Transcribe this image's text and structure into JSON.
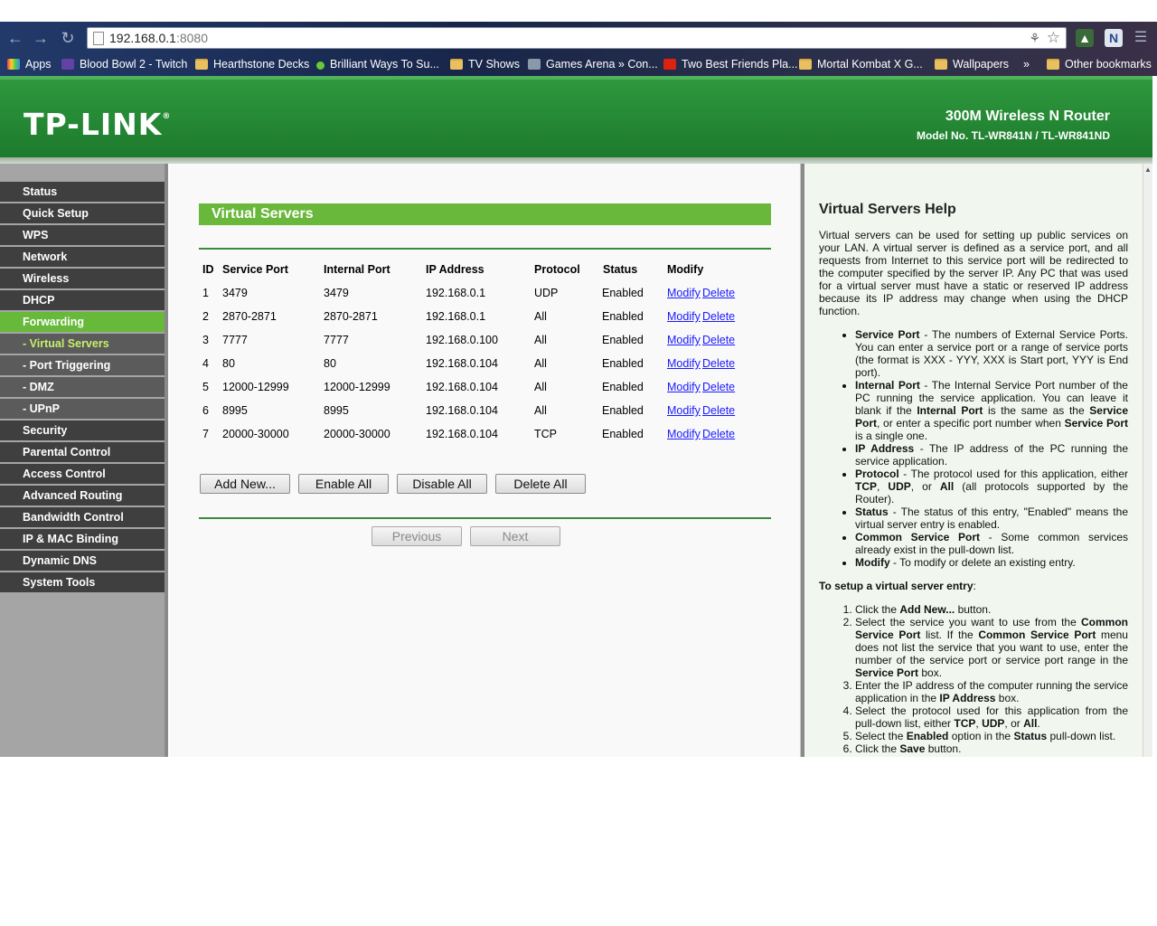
{
  "browser": {
    "url_host": "192.168.0.1",
    "url_port": ":8080",
    "bookmarks": [
      {
        "label": "Apps",
        "icon": "apps-grid-icon"
      },
      {
        "label": "Blood Bowl 2 - Twitch",
        "icon": "twitch-icon"
      },
      {
        "label": "Hearthstone Decks",
        "icon": "folder-icon"
      },
      {
        "label": "Brilliant Ways To Su...",
        "icon": "green-dot-icon"
      },
      {
        "label": "TV Shows",
        "icon": "folder-icon"
      },
      {
        "label": "Games Arena » Con...",
        "icon": "site-icon"
      },
      {
        "label": "Two Best Friends Pla...",
        "icon": "youtube-icon"
      },
      {
        "label": "Mortal Kombat X G...",
        "icon": "folder-icon"
      },
      {
        "label": "Wallpapers",
        "icon": "folder-icon"
      },
      {
        "label": "»",
        "icon": ""
      },
      {
        "label": "Other bookmarks",
        "icon": "folder-icon"
      }
    ]
  },
  "header": {
    "logo": "TP-LINK",
    "product": "300M Wireless N Router",
    "model": "Model No. TL-WR841N / TL-WR841ND"
  },
  "sidebar": {
    "items": [
      {
        "label": "Status"
      },
      {
        "label": "Quick Setup"
      },
      {
        "label": "WPS"
      },
      {
        "label": "Network"
      },
      {
        "label": "Wireless"
      },
      {
        "label": "DHCP"
      },
      {
        "label": "Forwarding"
      },
      {
        "label": "- Virtual Servers"
      },
      {
        "label": "- Port Triggering"
      },
      {
        "label": "- DMZ"
      },
      {
        "label": "- UPnP"
      },
      {
        "label": "Security"
      },
      {
        "label": "Parental Control"
      },
      {
        "label": "Access Control"
      },
      {
        "label": "Advanced Routing"
      },
      {
        "label": "Bandwidth Control"
      },
      {
        "label": "IP & MAC Binding"
      },
      {
        "label": "Dynamic DNS"
      },
      {
        "label": "System Tools"
      }
    ]
  },
  "main": {
    "title": "Virtual Servers",
    "columns": [
      "ID",
      "Service Port",
      "Internal Port",
      "IP Address",
      "Protocol",
      "Status",
      "Modify"
    ],
    "rows": [
      {
        "id": "1",
        "service_port": "3479",
        "internal_port": "3479",
        "ip": "192.168.0.1",
        "protocol": "UDP",
        "status": "Enabled"
      },
      {
        "id": "2",
        "service_port": "2870-2871",
        "internal_port": "2870-2871",
        "ip": "192.168.0.1",
        "protocol": "All",
        "status": "Enabled"
      },
      {
        "id": "3",
        "service_port": "7777",
        "internal_port": "7777",
        "ip": "192.168.0.100",
        "protocol": "All",
        "status": "Enabled"
      },
      {
        "id": "4",
        "service_port": "80",
        "internal_port": "80",
        "ip": "192.168.0.104",
        "protocol": "All",
        "status": "Enabled"
      },
      {
        "id": "5",
        "service_port": "12000-12999",
        "internal_port": "12000-12999",
        "ip": "192.168.0.104",
        "protocol": "All",
        "status": "Enabled"
      },
      {
        "id": "6",
        "service_port": "8995",
        "internal_port": "8995",
        "ip": "192.168.0.104",
        "protocol": "All",
        "status": "Enabled"
      },
      {
        "id": "7",
        "service_port": "20000-30000",
        "internal_port": "20000-30000",
        "ip": "192.168.0.104",
        "protocol": "TCP",
        "status": "Enabled"
      }
    ],
    "modify_label": "Modify",
    "delete_label": "Delete",
    "buttons": {
      "add_new": "Add New...",
      "enable_all": "Enable All",
      "disable_all": "Disable All",
      "delete_all": "Delete All"
    },
    "pager": {
      "previous": "Previous",
      "next": "Next"
    }
  },
  "help": {
    "title": "Virtual Servers Help",
    "intro": "Virtual servers can be used for setting up public services on your LAN. A virtual server is defined as a service port, and all requests from Internet to this service port will be redirected to the computer specified by the server IP. Any PC that was used for a virtual server must have a static or reserved IP address because its IP address may change when using the DHCP function.",
    "b1_term": "Service Port",
    "b1_text": " - The numbers of External Service Ports. You can enter a service port or a range of service ports (the format is XXX - YYY, XXX is Start port, YYY is End port).",
    "b2_term": "Internal Port",
    "b2_text_a": " - The Internal Service Port number of the PC running the service application. You can leave it blank if the ",
    "b2_term2": "Internal Port",
    "b2_text_b": " is the same as the ",
    "b2_term3": "Service Port",
    "b2_text_c": ", or enter a specific port number when ",
    "b2_term4": "Service Port",
    "b2_text_d": " is a single one.",
    "b3_term": "IP Address",
    "b3_text": " - The IP address of the PC running the service application.",
    "b4_term": "Protocol",
    "b4_text_a": " - The protocol used for this application, either ",
    "b4_tcp": "TCP",
    "b4_sep1": ", ",
    "b4_udp": "UDP",
    "b4_sep2": ", or ",
    "b4_all": "All",
    "b4_text_b": " (all protocols supported by the Router).",
    "b5_term": "Status",
    "b5_text": " - The status of this entry, \"Enabled\" means the virtual server entry is enabled.",
    "b6_term": "Common Service Port",
    "b6_text": " - Some common services already exist in the pull-down list.",
    "b7_term": "Modify",
    "b7_text": " - To modify or delete an existing entry.",
    "setup_term": "To setup a virtual server entry",
    "setup_colon": ":",
    "s1_a": "Click the ",
    "s1_b": "Add New...",
    "s1_c": " button.",
    "s2_a": "Select the service you want to use from the ",
    "s2_b": "Common Service Port",
    "s2_c": " list. If the ",
    "s2_d": "Common Service Port",
    "s2_e": " menu does not list the service that you want to use, enter the number of the service port or service port range in the ",
    "s2_f": "Service Port",
    "s2_g": " box.",
    "s3_a": "Enter the IP address of the computer running the service application in the ",
    "s3_b": "IP Address",
    "s3_c": " box.",
    "s4_a": "Select the protocol used for this application from the pull-down list, either ",
    "s4_b": "TCP",
    "s4_c": ", ",
    "s4_d": "UDP",
    "s4_e": ", or ",
    "s4_f": "All",
    "s4_g": ".",
    "s5_a": "Select the ",
    "s5_b": "Enabled",
    "s5_c": " option in the ",
    "s5_d": "Status",
    "s5_e": " pull-down list.",
    "s6_a": "Click the ",
    "s6_b": "Save",
    "s6_c": " button."
  }
}
